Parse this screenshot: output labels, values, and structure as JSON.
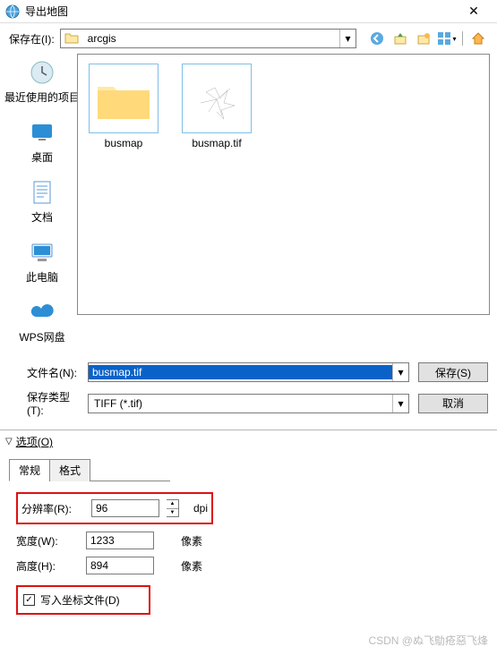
{
  "window": {
    "title": "导出地图"
  },
  "save_in": {
    "label": "保存在(I):",
    "value": "arcgis"
  },
  "toolbar_icons": [
    "back-icon",
    "up-icon",
    "new-folder-icon",
    "view-menu-icon",
    "home-icon"
  ],
  "places": [
    {
      "icon": "recent-icon",
      "label": "最近使用的项目"
    },
    {
      "icon": "desktop-icon",
      "label": "桌面"
    },
    {
      "icon": "documents-icon",
      "label": "文档"
    },
    {
      "icon": "this-pc-icon",
      "label": "此电脑"
    },
    {
      "icon": "wps-icon",
      "label": "WPS网盘"
    }
  ],
  "files": [
    {
      "kind": "folder",
      "name": "busmap"
    },
    {
      "kind": "image",
      "name": "busmap.tif"
    }
  ],
  "filename": {
    "label": "文件名(N):",
    "value": "busmap.tif"
  },
  "filetype": {
    "label": "保存类型(T):",
    "value": "TIFF (*.tif)"
  },
  "buttons": {
    "save": "保存(S)",
    "cancel": "取消"
  },
  "options_header": "选项(O)",
  "tabs": {
    "general": "常规",
    "format": "格式"
  },
  "opts": {
    "resolution_label": "分辨率(R):",
    "resolution_value": "96",
    "resolution_unit": "dpi",
    "width_label": "宽度(W):",
    "width_value": "1233",
    "width_unit": "像素",
    "height_label": "高度(H):",
    "height_value": "894",
    "height_unit": "像素",
    "write_world_label": "写入坐标文件(D)",
    "write_world_checked": "✓"
  },
  "watermark": "CSDN @ぬ飞鳨疮惡飞烽"
}
